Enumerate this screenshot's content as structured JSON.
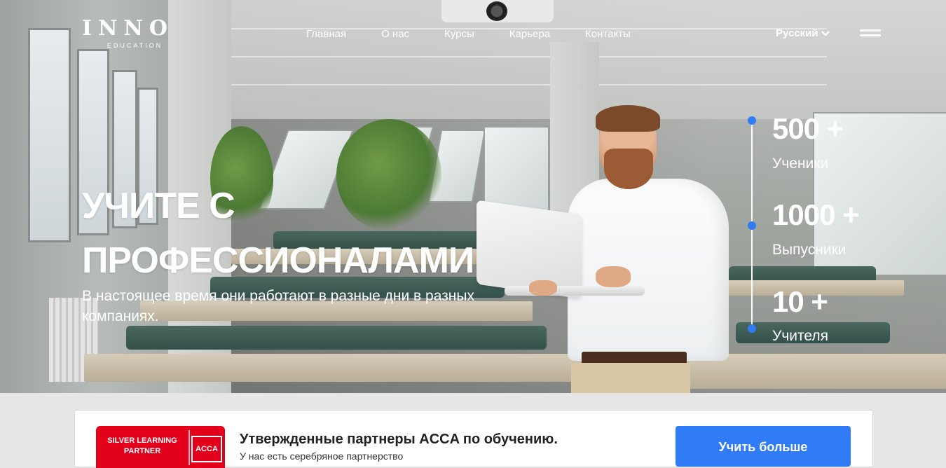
{
  "brand": {
    "name": "INNO",
    "tagline": "EDUCATION"
  },
  "nav": {
    "items": [
      {
        "label": "Главная"
      },
      {
        "label": "О нас"
      },
      {
        "label": "Курсы"
      },
      {
        "label": "Карьера"
      },
      {
        "label": "Контакты"
      }
    ],
    "language": "Русский"
  },
  "hero": {
    "headline_line1": "УЧИТЕ С",
    "headline_line2": "ПРОФЕССИОНАЛАМИ",
    "subtitle": "В настоящее время они работают в разные дни в разных компаниях."
  },
  "stats": [
    {
      "value": "500 +",
      "label": "Ученики"
    },
    {
      "value": "1000 +",
      "label": "Выпусники"
    },
    {
      "value": "10 +",
      "label": "Учителя"
    }
  ],
  "partner": {
    "badge_text": "SILVER LEARNING PARTNER",
    "badge_logo": "ACCA",
    "title": "Утвержденные партнеры ACCA по обучению.",
    "description": "У нас есть серебряное партнерство",
    "cta": "Учить больше"
  },
  "colors": {
    "accent": "#2f7cf6",
    "badge": "#e3001b"
  }
}
